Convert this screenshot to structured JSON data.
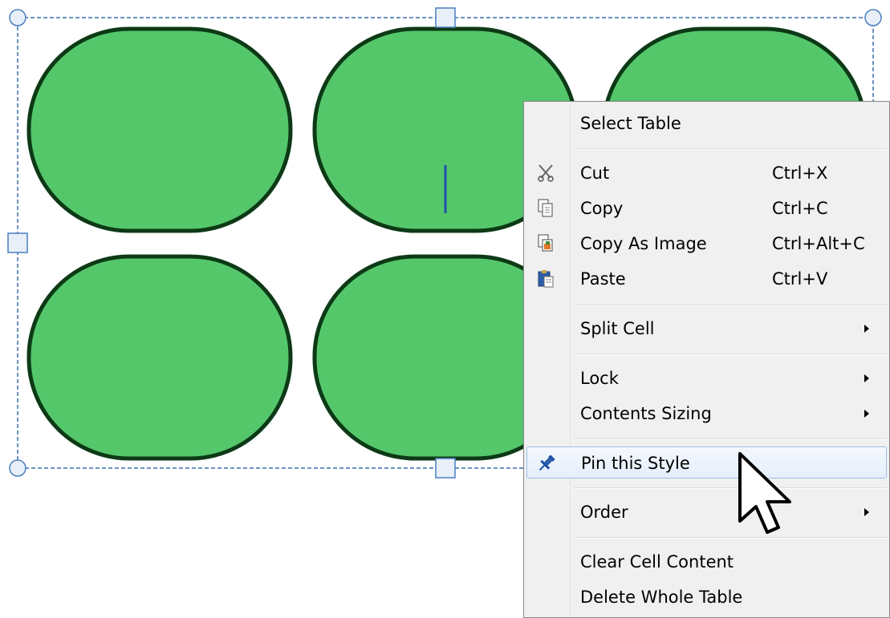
{
  "canvas": {
    "shape_fill": "#55c76b",
    "shape_stroke": "#0d3a16",
    "selection_color": "#3a6fb0"
  },
  "context_menu": {
    "items": [
      {
        "label": "Select Table",
        "shortcut": "",
        "submenu": false,
        "icon": ""
      },
      {
        "label": "Cut",
        "shortcut": "Ctrl+X",
        "submenu": false,
        "icon": "scissors-icon"
      },
      {
        "label": "Copy",
        "shortcut": "Ctrl+C",
        "submenu": false,
        "icon": "copy-icon"
      },
      {
        "label": "Copy As Image",
        "shortcut": "Ctrl+Alt+C",
        "submenu": false,
        "icon": "copy-image-icon"
      },
      {
        "label": "Paste",
        "shortcut": "Ctrl+V",
        "submenu": false,
        "icon": "paste-icon"
      },
      {
        "label": "Split Cell",
        "shortcut": "",
        "submenu": true,
        "icon": ""
      },
      {
        "label": "Lock",
        "shortcut": "",
        "submenu": true,
        "icon": ""
      },
      {
        "label": "Contents Sizing",
        "shortcut": "",
        "submenu": true,
        "icon": ""
      },
      {
        "label": "Pin this Style",
        "shortcut": "",
        "submenu": false,
        "icon": "pin-icon",
        "highlighted": true
      },
      {
        "label": "Order",
        "shortcut": "",
        "submenu": true,
        "icon": ""
      },
      {
        "label": "Clear Cell Content",
        "shortcut": "",
        "submenu": false,
        "icon": ""
      },
      {
        "label": "Delete Whole Table",
        "shortcut": "",
        "submenu": false,
        "icon": ""
      }
    ]
  }
}
